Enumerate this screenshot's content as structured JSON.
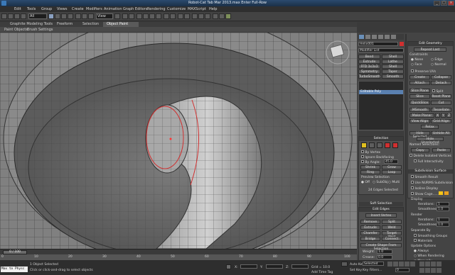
{
  "window": {
    "title": "Robot-Cat Tab Mar 2013.max   Enter Full-Row"
  },
  "menus": [
    "Edit",
    "Tools",
    "Group",
    "Views",
    "Create",
    "Modifiers",
    "Animation",
    "Graph Editors",
    "Rendering",
    "Customize",
    "MAXScript",
    "Help"
  ],
  "toolbar": {
    "selection_filter": "All",
    "view_dropdown": "View"
  },
  "ribbon": {
    "tabs": [
      "Graphite Modeling Tools",
      "Freeform",
      "Selection",
      "Object Paint"
    ],
    "subtabs": [
      "Paint Objects",
      "Brush Settings"
    ]
  },
  "panel": {
    "object_name": "Helix001",
    "modifier_list": "Modifier List",
    "modifier_buttons": [
      "Bend",
      "Shell",
      "Extrude",
      "Lathe",
      "FFD 3x3x3",
      "Shell",
      "Symmetry",
      "Taper",
      "TurboSmooth",
      "Smooth"
    ],
    "stack_item": "Editable Poly",
    "selection": {
      "header": "Selection",
      "by_vertex": "By Vertex",
      "ignore_backfacing": "Ignore Backfacing",
      "by_angle": "By Angle:",
      "angle_value": "45.0",
      "shrink": "Shrink",
      "grow": "Grow",
      "ring": "Ring",
      "loop": "Loop",
      "preview": "Preview Selection",
      "off": "Off",
      "subobj": "SubObj",
      "multi": "Multi",
      "status": "24 Edges Selected"
    },
    "soft_selection": "Soft Selection",
    "edit_edges": {
      "header": "Edit Edges",
      "insert_vertex": "Insert Vertex",
      "remove": "Remove",
      "split": "Split",
      "extrude": "Extrude",
      "weld": "Weld",
      "chamfer": "Chamfer",
      "target_weld": "Target Weld",
      "bridge": "Bridge",
      "connect": "Connect",
      "create_shape": "Create Shape From Selection",
      "weight": "Weight:",
      "weight_value": "1.0",
      "crease": "Crease:",
      "crease_value": "0.0"
    },
    "edit_geometry": {
      "header": "Edit Geometry",
      "repeat_last": "Repeat Last",
      "constraints": "Constraints",
      "none": "None",
      "edge": "Edge",
      "face": "Face",
      "normal": "Normal",
      "preserve_uvs": "Preserve UVs",
      "create": "Create",
      "collapse": "Collapse",
      "attach": "Attach",
      "detach": "Detach",
      "slice_plane": "Slice Plane",
      "split": "Split",
      "slice": "Slice",
      "reset_plane": "Reset Plane",
      "quickslice": "QuickSlice",
      "cut": "Cut",
      "msmooth": "MSmooth",
      "tessellate": "Tessellate",
      "make_planar": "Make Planar",
      "x": "X",
      "y": "Y",
      "z": "Z",
      "view_align": "View Align",
      "grid_align": "Grid Align",
      "relax": "Relax",
      "hide_selected": "Hide Selected",
      "unhide_all": "Unhide All",
      "hide_unselected": "Hide Unselected",
      "named_selections": "Named Selections:",
      "copy": "Copy",
      "paste": "Paste",
      "delete_isolated": "Delete Isolated Vertices",
      "full_interactivity": "Full Interactivity"
    },
    "subdivision_surface": {
      "header": "Subdivision Surface",
      "smooth_result": "Smooth Result",
      "use_nurms": "Use NURMS Subdivision",
      "isoline": "Isoline Display",
      "show_cage": "Show Cage......",
      "display": "Display",
      "iterations": "Iterations:",
      "iterations_value": "1",
      "smoothness": "Smoothness:",
      "smoothness_value": "1.0",
      "render": "Render",
      "separate_by": "Separate By",
      "smoothing_groups": "Smoothing Groups",
      "materials": "Materials",
      "update_options": "Update Options",
      "always": "Always",
      "when_rendering": "When Rendering",
      "manually": "Manually"
    }
  },
  "timeline": {
    "frame": "0 / 100",
    "ticks": [
      "0",
      "10",
      "20",
      "30",
      "40",
      "50",
      "60",
      "70",
      "80",
      "90",
      "100"
    ]
  },
  "status": {
    "maxscript": "Max to Physc",
    "objects_selected": "1 Object Selected",
    "prompt": "Click or click-and-drag to select objects",
    "x": "X:",
    "y": "Y:",
    "z": "Z:",
    "grid": "Grid = 10.0",
    "auto_key": "Auto Key",
    "selected": "Selected",
    "set_key": "Set Key",
    "key_filters": "Key Filters...",
    "add_time_tag": "Add Time Tag",
    "frame_value": "0"
  },
  "colors": {
    "accent": "#f5c518",
    "edge_selected": "#d03030"
  }
}
